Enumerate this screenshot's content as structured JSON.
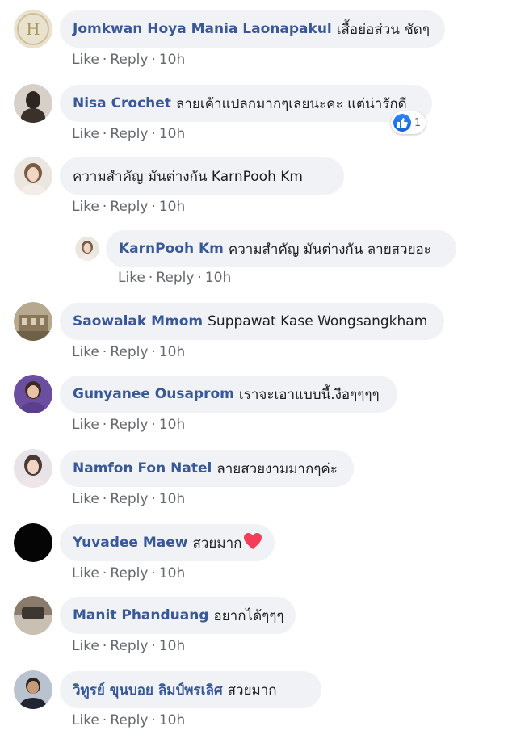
{
  "actions": {
    "like": "Like",
    "reply": "Reply",
    "separator": "·"
  },
  "comments": [
    {
      "author": "Jomkwan Hoya Mania Laonapakul",
      "text": "เสื้อย่อส่วน ชัดๆ",
      "time": "10h",
      "avatar": "H"
    },
    {
      "author": "Nisa Crochet",
      "text": "ลายเค้าแปลกมากๆเลยนะคะ แต่น่ารักดี",
      "time": "10h",
      "reactions": {
        "count": "1",
        "icon": "like-icon"
      }
    },
    {
      "author": "",
      "text": "ความสำคัญ มันต่างกัน KarnPooh Km",
      "time": "10h"
    },
    {
      "author": "KarnPooh Km",
      "text": "ความสำคัญ มันต่างกัน ลายสวยอะ",
      "time": "10h"
    },
    {
      "author": "Saowalak Mmom",
      "text": "Suppawat Kase Wongsangkham",
      "time": "10h"
    },
    {
      "author": "Gunyanee Ousaprom",
      "text": "เราจะเอาแบบนี้.งือๆๆๆๆ",
      "time": "10h"
    },
    {
      "author": "Namfon Fon Natel",
      "text": "ลายสวยงามมากๆค่ะ",
      "time": "10h"
    },
    {
      "author": "Yuvadee Maew",
      "text": "สวยมาก",
      "time": "10h",
      "emoji": "heart-icon"
    },
    {
      "author": "Manit Phanduang",
      "text": "อยากได้ๆๆๆ",
      "time": "10h"
    },
    {
      "author": "วิทูรย์ ขุนบอย ลิมป์พรเลิศ",
      "text": "สวยมาก",
      "time": "10h"
    }
  ],
  "colors": {
    "bubble": "#f0f2f5",
    "author": "#385898",
    "text": "#1c1e21",
    "meta": "#65676b",
    "like_blue": "#1877f2",
    "heart_red": "#f33e58"
  }
}
